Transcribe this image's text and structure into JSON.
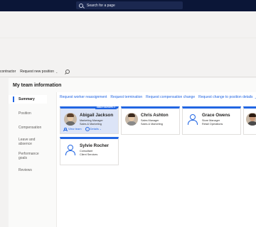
{
  "header": {
    "search_placeholder": "Search for a page"
  },
  "toolbar": {
    "items": [
      {
        "label": "contractor"
      },
      {
        "label": "Request new position",
        "chevron": "⌄"
      }
    ]
  },
  "page": {
    "title": "My team information"
  },
  "nav": {
    "items": [
      {
        "label": "Summary"
      },
      {
        "label": "Position"
      },
      {
        "label": "Compensation"
      },
      {
        "label": "Leave and absence"
      },
      {
        "label": "Performance goals"
      },
      {
        "label": "Reviews"
      }
    ],
    "selected": "Summary"
  },
  "actions": [
    {
      "label": "Request worker reassignment"
    },
    {
      "label": "Request termination"
    },
    {
      "label": "Request compensation change"
    },
    {
      "label": "Request change to position details",
      "chevron": "⌄"
    }
  ],
  "cards": [
    {
      "name": "Abigail Jackson",
      "role": "Marketing Manager",
      "dept": "Sales & Marketing",
      "tag": "DIRECT REPORTS: 2",
      "view_team": "View team",
      "details": "Details",
      "chevron": "⌄"
    },
    {
      "name": "Chris Ashton",
      "role": "Sales Manager",
      "dept": "Sales & Marketing"
    },
    {
      "name": "Grace Owens",
      "role": "Store Manager",
      "dept": "Retail Operations"
    },
    {
      "name": "Sylvie Rocher",
      "role": "Consultant",
      "dept": "Client Services"
    }
  ],
  "colors": {
    "accent": "#2266e3",
    "topbar": "#0b1637",
    "selected_card": "#dce4f7"
  },
  "icons": [
    "search-icon",
    "person-icon",
    "people-icon",
    "info-icon",
    "chevron-down-icon"
  ]
}
